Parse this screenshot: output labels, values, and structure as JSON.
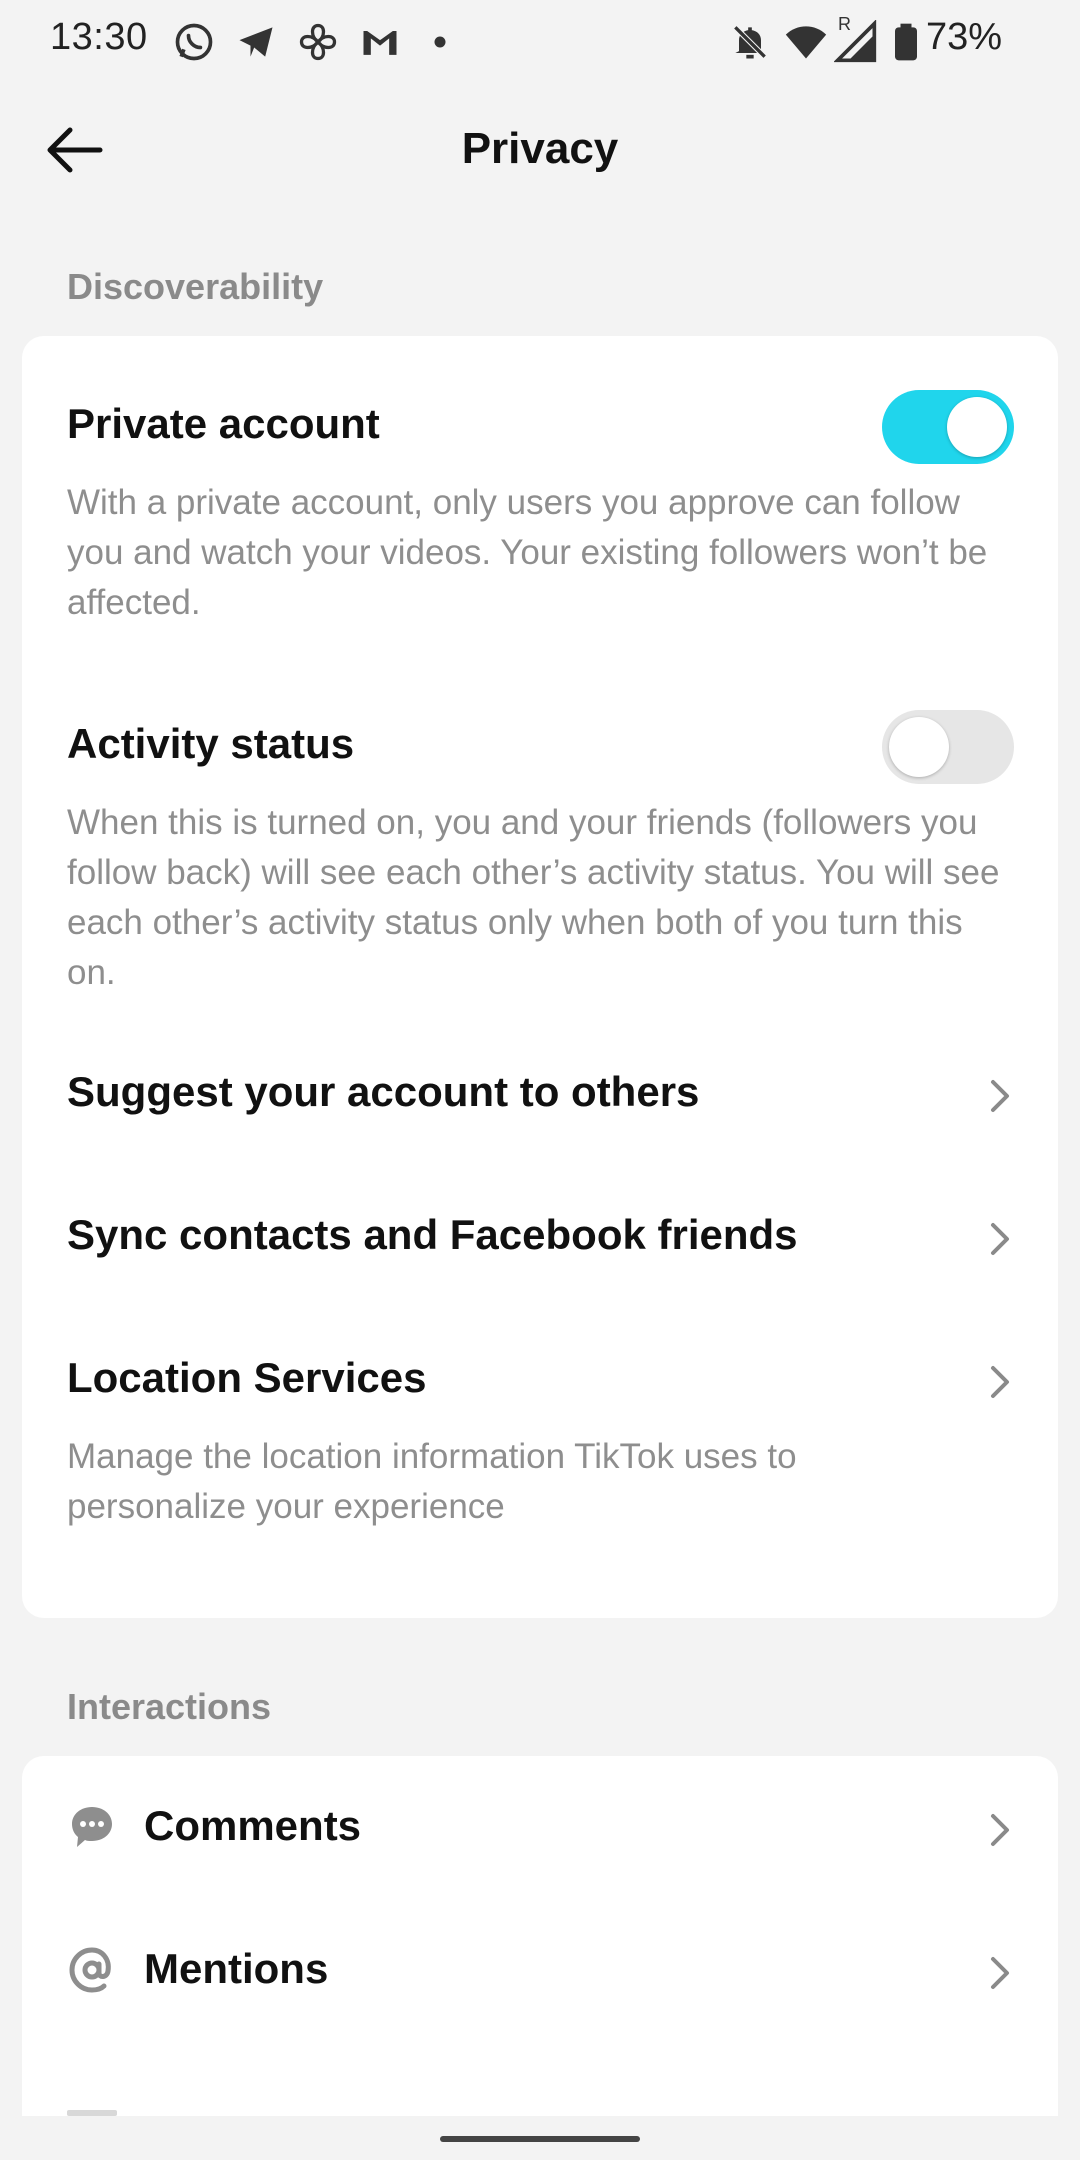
{
  "status_bar": {
    "time": "13:30",
    "battery": "73%",
    "icons_left": [
      "whatsapp-icon",
      "telegram-icon",
      "pinwheel-icon",
      "gmail-icon",
      "dot-icon"
    ],
    "icons_right": [
      "bell-off-icon",
      "wifi-icon",
      "signal-icon",
      "battery-icon"
    ],
    "roaming": "R"
  },
  "header": {
    "title": "Privacy"
  },
  "sections": {
    "discoverability": {
      "label": "Discoverability",
      "private_account": {
        "title": "Private account",
        "description": "With a private account, only users you approve can follow you and watch your videos. Your existing followers won’t be affected.",
        "enabled": true
      },
      "activity_status": {
        "title": "Activity status",
        "description": "When this is turned on, you and your friends (followers you follow back) will see each other’s activity status. You will see each other’s activity status only when both of you turn this on.",
        "enabled": false
      },
      "suggest": {
        "title": "Suggest your account to others"
      },
      "sync": {
        "title": "Sync contacts and Facebook friends"
      },
      "location": {
        "title": "Location Services",
        "description": "Manage the location information TikTok uses to personalize your experience"
      }
    },
    "interactions": {
      "label": "Interactions",
      "comments": {
        "title": "Comments",
        "icon": "comment-icon"
      },
      "mentions": {
        "title": "Mentions",
        "icon": "at-icon"
      }
    }
  },
  "colors": {
    "accent": "#20d5ec",
    "background": "#f3f3f3",
    "muted_text": "#8e8e8e"
  }
}
